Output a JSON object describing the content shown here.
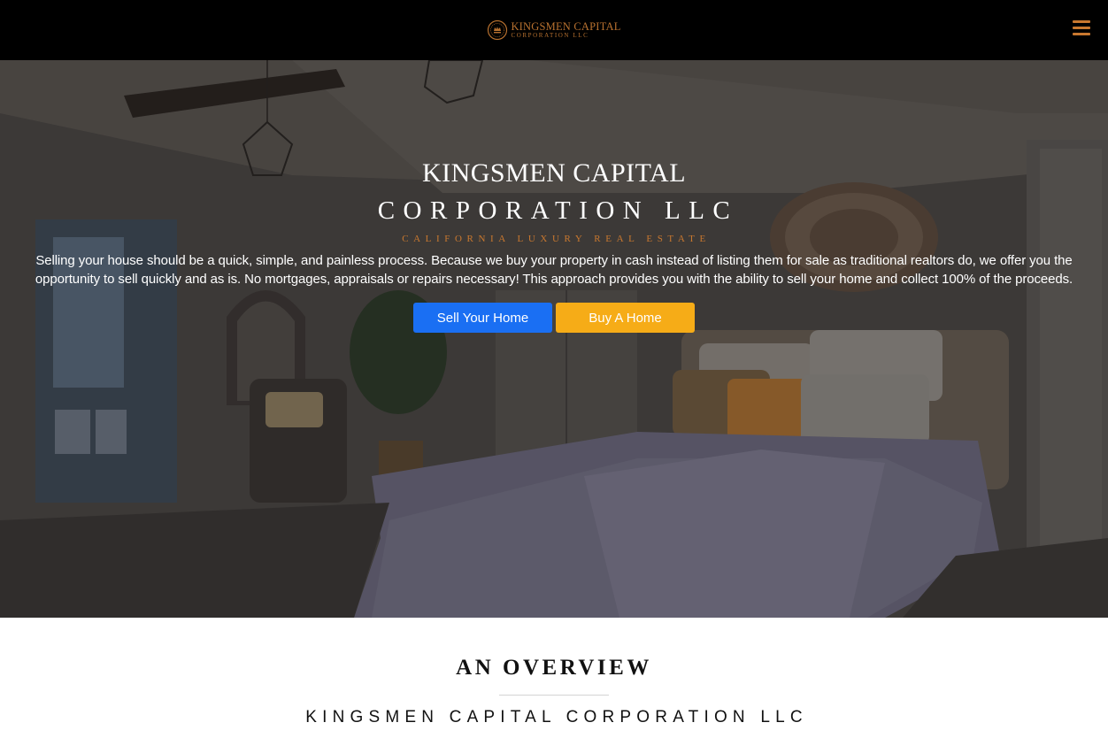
{
  "header": {
    "logo_line1": "KINGSMEN CAPITAL",
    "logo_line2": "CORPORATION LLC",
    "menu_icon": "hamburger-menu-icon",
    "accent_color": "#c9782f"
  },
  "hero": {
    "title_line1": "KINGSMEN CAPITAL",
    "title_line2": "CORPORATION LLC",
    "tagline": "CALIFORNIA LUXURY REAL ESTATE",
    "description": "Selling your house should be a quick, simple, and painless process. Because we buy your property in cash instead of listing them for sale as traditional realtors do, we offer you the opportunity to sell quickly and as is. No mortgages, appraisals or repairs necessary! This approach provides you with the ability to sell your home and collect 100% of the proceeds.",
    "buttons": {
      "sell_label": "Sell Your Home",
      "sell_color": "#1a6ff3",
      "buy_label": "Buy A Home",
      "buy_color": "#f6ac17"
    }
  },
  "overview": {
    "heading": "AN OVERVIEW",
    "subheading": "KINGSMEN CAPITAL CORPORATION LLC"
  }
}
